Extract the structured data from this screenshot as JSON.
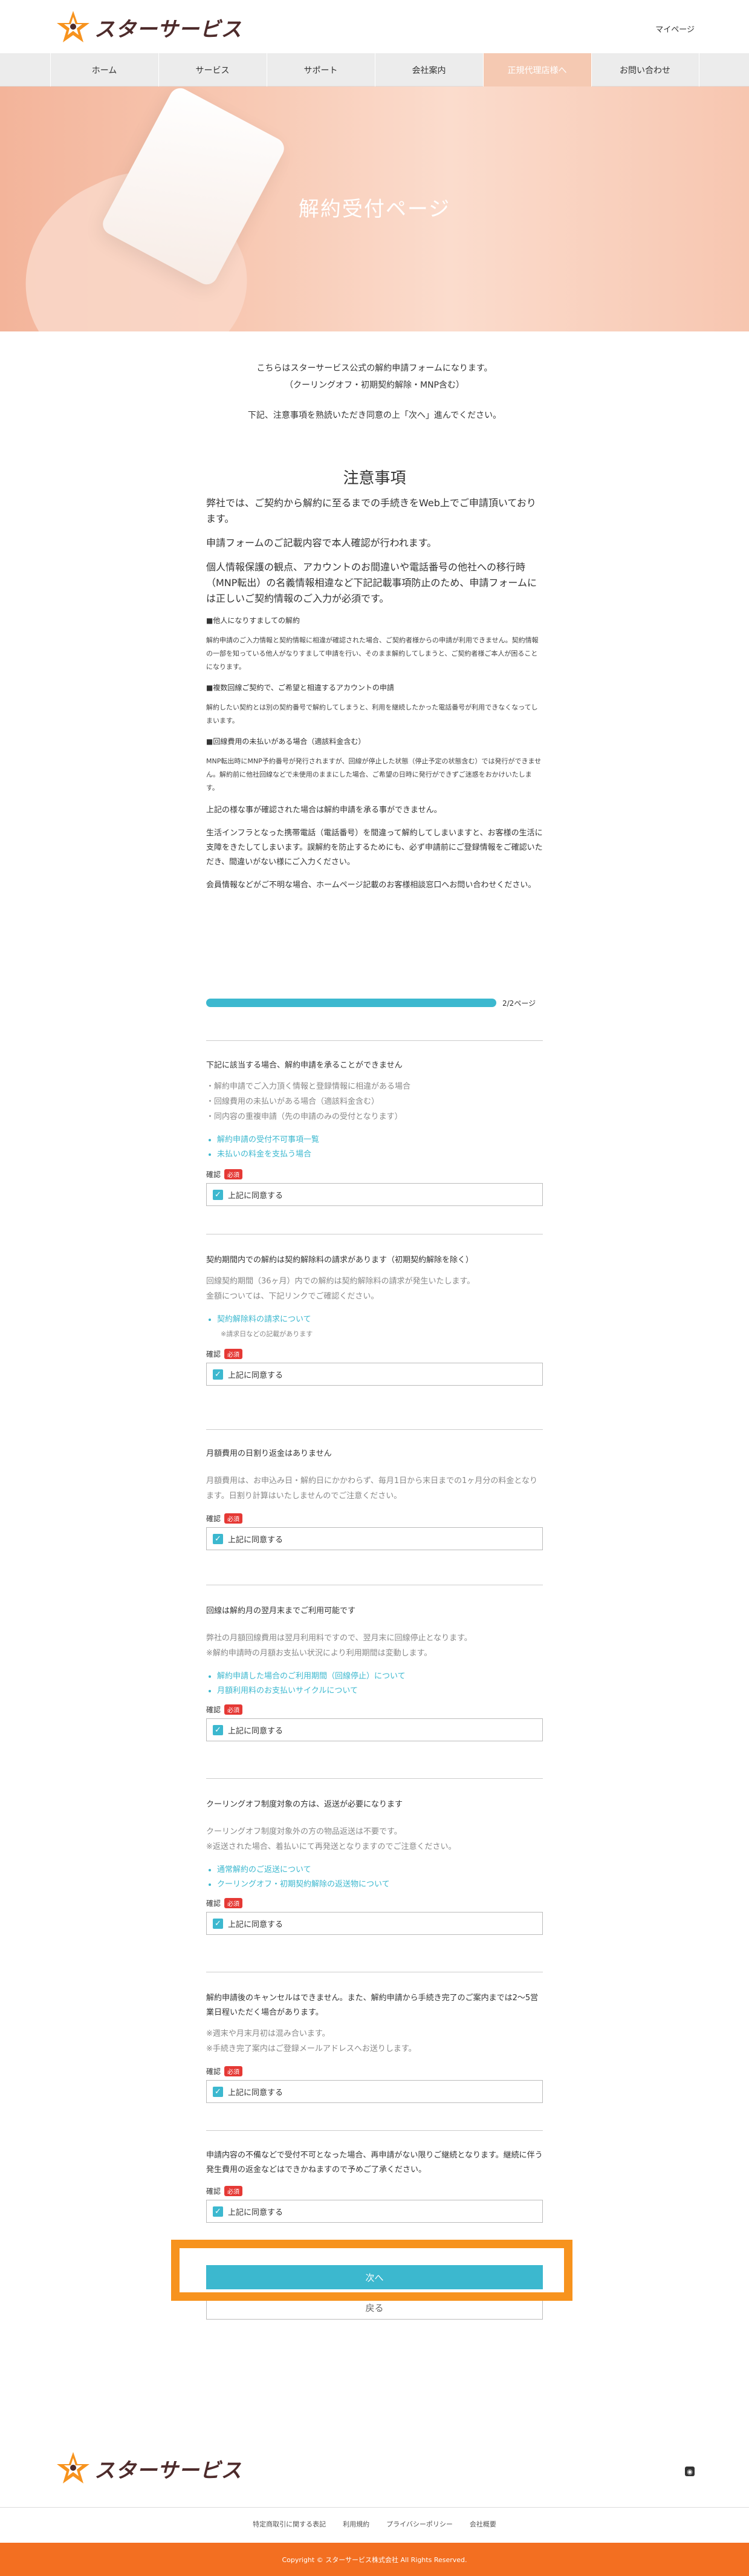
{
  "header": {
    "logo_text": "スターサービス",
    "mypage_label": "マイページ"
  },
  "nav": {
    "items": [
      "ホーム",
      "サービス",
      "サポート",
      "会社案内",
      "正規代理店様へ",
      "お問い合わせ"
    ]
  },
  "hero": {
    "title": "解約受付ページ"
  },
  "intro": {
    "line1": "こちらはスターサービス公式の解約申請フォームになります。",
    "line2": "（クーリングオフ・初期契約解除・MNP含む）",
    "line3": "下記、注意事項を熟読いただき同意の上「次へ」進んでください。"
  },
  "notes": {
    "title": "注意事項",
    "p1": "弊社では、ご契約から解約に至るまでの手続きをWeb上でご申請頂いております。",
    "p2": "申請フォームのご記載内容で本人確認が行われます。",
    "p3": "個人情報保護の観点、アカウントのお間違いや電話番号の他社への移行時（MNP転出）の名義情報相違など下記記載事項防止のため、申請フォームには正しいご契約情報のご入力が必須です。",
    "h1": "■他人になりすましての解約",
    "s1": "解約申請のご入力情報と契約情報に相違が確認された場合、ご契約者様からの申請が利用できません。契約情報の一部を知っている他人がなりすまして申請を行い、そのまま解約してしまうと、ご契約者様ご本人が困ることになります。",
    "h2": "■複数回線ご契約で、ご希望と相違するアカウントの申請",
    "s2": "解約したい契約とは別の契約番号で解約してしまうと、利用を継続したかった電話番号が利用できなくなってしまいます。",
    "h3": "■回線費用の未払いがある場合（適該料金含む）",
    "s3": "MNP転出時にMNP予約番号が発行されますが、回線が停止した状態（停止予定の状態含む）では発行ができません。解約前に他社回線などで未使用のままにした場合、ご希望の日時に発行ができずご迷惑をおかけいたします。",
    "p4": "上記の様な事が確認された場合は解約申請を承る事ができません。",
    "p5": "生活インフラとなった携帯電話（電話番号）を間違って解約してしまいますと、お客様の生活に支障をきたしてしまいます。誤解約を防止するためにも、必ず申請前にご登録情報をご確認いただき、間違いがない様にご入力ください。",
    "p6": "会員情報などがご不明な場合、ホームページ記載のお客様相談窓口へお問い合わせください。"
  },
  "progress": {
    "label": "2/2ページ",
    "fraction": 1.0
  },
  "sections": [
    {
      "title": "下記に該当する場合、解約申請を承ることができません",
      "body": [
        "・解約申請でご入力頂く情報と登録情報に相違がある場合",
        "・回線費用の未払いがある場合（適該料金含む）",
        "・同内容の重複申請（先の申請のみの受付となります）"
      ],
      "links": [
        {
          "text": "解約申請の受付不可事項一覧"
        },
        {
          "text": "未払いの料金を支払う場合"
        }
      ],
      "confirm_label": "確認",
      "required": "必須",
      "agree": "上記に同意する"
    },
    {
      "title": "契約期間内での解約は契約解除料の請求があります（初期契約解除を除く）",
      "body": [
        "回線契約期間（36ヶ月）内での解約は契約解除料の請求が発生いたします。",
        "金額については、下記リンクでご確認ください。"
      ],
      "links": [
        {
          "text": "契約解除料の請求について",
          "note": "※請求日などの記載があります"
        }
      ],
      "confirm_label": "確認",
      "required": "必須",
      "agree": "上記に同意する"
    },
    {
      "title": "月額費用の日割り返金はありません",
      "body": [
        "月額費用は、お申込み日・解約日にかかわらず、毎月1日から末日までの1ヶ月分の料金となります。日割り計算はいたしませんのでご注意ください。"
      ],
      "links": [],
      "confirm_label": "確認",
      "required": "必須",
      "agree": "上記に同意する"
    },
    {
      "title": "回線は解約月の翌月末までご利用可能です",
      "body": [
        "弊社の月額回線費用は翌月利用料ですので、翌月末に回線停止となります。",
        "※解約申請時の月額お支払い状況により利用期間は変動します。"
      ],
      "links": [
        {
          "text": "解約申請した場合のご利用期間（回線停止）について"
        },
        {
          "text": "月額利用料のお支払いサイクルについて"
        }
      ],
      "confirm_label": "確認",
      "required": "必須",
      "agree": "上記に同意する"
    },
    {
      "title": "クーリングオフ制度対象の方は、返送が必要になります",
      "body": [
        "クーリングオフ制度対象外の方の物品返送は不要です。",
        "※返送された場合、着払いにて再発送となりますのでご注意ください。"
      ],
      "links": [
        {
          "text": "通常解約のご返送について"
        },
        {
          "text": "クーリングオフ・初期契約解除の返送物について"
        }
      ],
      "confirm_label": "確認",
      "required": "必須",
      "agree": "上記に同意する"
    },
    {
      "title": "解約申請後のキャンセルはできません。また、解約申請から手続き完了のご案内までは2～5営業日程いただく場合があります。",
      "body": [
        "※週末や月末月初は混み合います。",
        "※手続き完了案内はご登録メールアドレスへお送りします。"
      ],
      "links": [],
      "confirm_label": "確認",
      "required": "必須",
      "agree": "上記に同意する"
    },
    {
      "title": "申請内容の不備などで受付不可となった場合、再申請がない限りご継続となります。継続に伴う発生費用の返金などはできかねますので予めご了承ください。",
      "body": [],
      "links": [],
      "confirm_label": "確認",
      "required": "必須",
      "agree": "上記に同意する"
    }
  ],
  "buttons": {
    "next": "次へ",
    "back": "戻る"
  },
  "footer": {
    "logo_text": "スターサービス",
    "links": [
      "特定商取引に関する表記",
      "利用規約",
      "プライバシーポリシー",
      "会社概要"
    ],
    "copyright": "Copyright © スターサービス株式会社 All Rights Reserved."
  },
  "colors": {
    "accent": "#3cb8cf",
    "orange": "#f36f21",
    "highlight": "#f7931e",
    "required": "#e53935"
  }
}
